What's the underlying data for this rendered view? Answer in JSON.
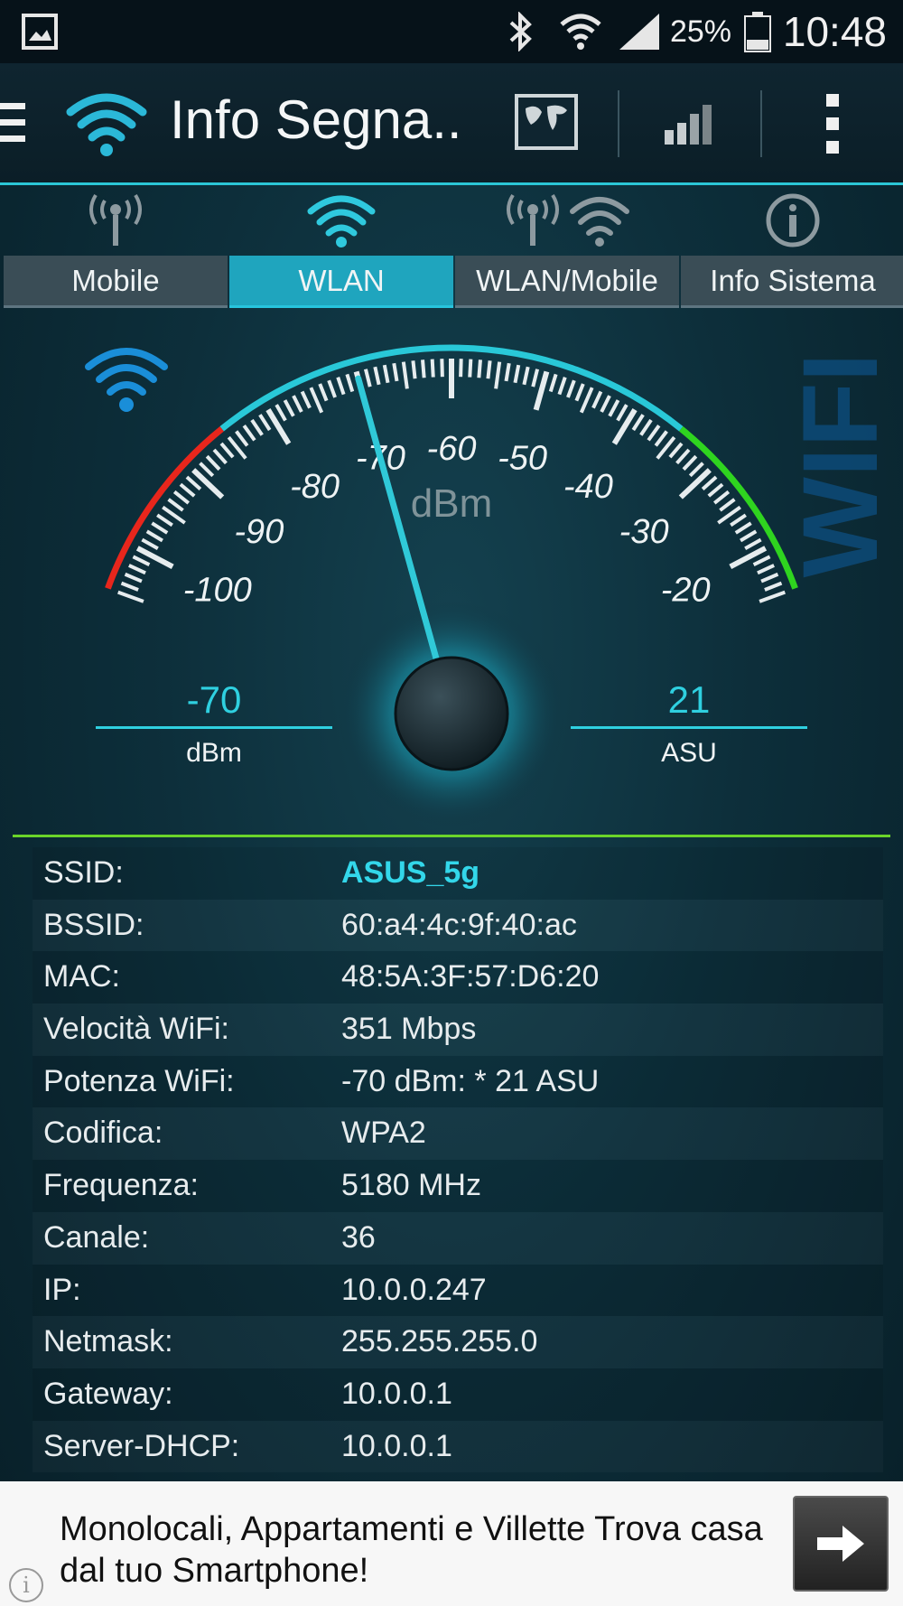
{
  "status_bar": {
    "battery_percent": "25%",
    "time": "10:48",
    "icons": [
      "gallery-icon",
      "bluetooth-icon",
      "wifi-icon",
      "cell-signal-icon",
      "battery-icon"
    ]
  },
  "action_bar": {
    "title": "Info Segna..",
    "icons": [
      "menu-icon",
      "wifi-logo-icon",
      "map-icon",
      "signal-bars-icon",
      "overflow-menu-icon"
    ]
  },
  "tabs": [
    {
      "label": "Mobile",
      "icon": "antenna-icon",
      "active": false
    },
    {
      "label": "WLAN",
      "icon": "wifi-icon",
      "active": true
    },
    {
      "label": "WLAN/Mobile",
      "icon": "antenna-wifi-icon",
      "active": false
    },
    {
      "label": "Info Sistema",
      "icon": "info-icon",
      "active": false
    }
  ],
  "gauge": {
    "unit_label": "dBm",
    "watermark": "WIFI",
    "min": -105,
    "max": -15,
    "value": -70,
    "tick_labels": [
      "-100",
      "-90",
      "-80",
      "-70",
      "-60",
      "-50",
      "-40",
      "-30",
      "-20"
    ],
    "colors": {
      "weak": "#e8261c",
      "mid": "#29c8d8",
      "strong": "#2fd41f"
    },
    "readout_left": {
      "value": "-70",
      "unit": "dBm"
    },
    "readout_right": {
      "value": "21",
      "unit": "ASU"
    }
  },
  "info": [
    {
      "key": "SSID:",
      "value": "ASUS_5g"
    },
    {
      "key": "BSSID:",
      "value": "60:a4:4c:9f:40:ac"
    },
    {
      "key": "MAC:",
      "value": "48:5A:3F:57:D6:20"
    },
    {
      "key": "Velocità WiFi:",
      "value": "351 Mbps"
    },
    {
      "key": "Potenza WiFi:",
      "value": "-70 dBm: * 21 ASU"
    },
    {
      "key": "Codifica:",
      "value": "WPA2"
    },
    {
      "key": "Frequenza:",
      "value": "5180 MHz"
    },
    {
      "key": "Canale:",
      "value": "36"
    },
    {
      "key": "IP:",
      "value": "10.0.0.247"
    },
    {
      "key": "Netmask:",
      "value": "255.255.255.0"
    },
    {
      "key": "Gateway:",
      "value": "10.0.0.1"
    },
    {
      "key": "Server-DHCP:",
      "value": "10.0.0.1"
    }
  ],
  "ad": {
    "text": "Monolocali, Appartamenti e Villette Trova casa dal tuo Smartphone!",
    "info_glyph": "i"
  }
}
